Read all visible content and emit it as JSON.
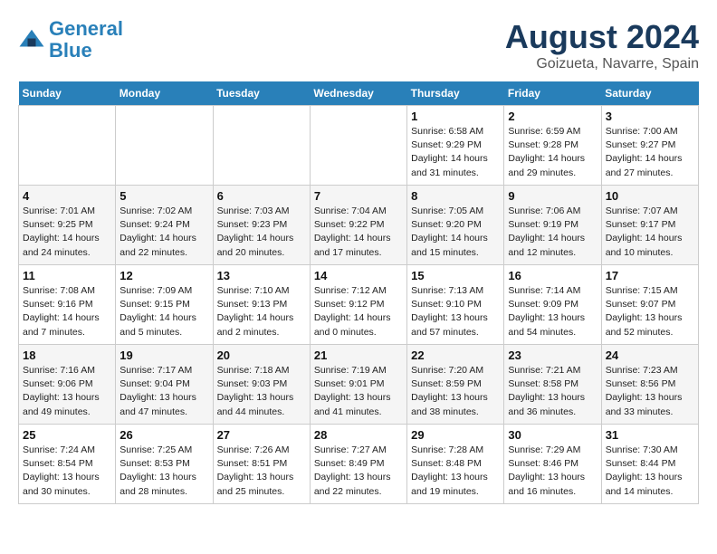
{
  "header": {
    "logo_line1": "General",
    "logo_line2": "Blue",
    "month_title": "August 2024",
    "location": "Goizueta, Navarre, Spain"
  },
  "weekdays": [
    "Sunday",
    "Monday",
    "Tuesday",
    "Wednesday",
    "Thursday",
    "Friday",
    "Saturday"
  ],
  "weeks": [
    [
      {
        "day": "",
        "sunrise": "",
        "sunset": "",
        "daylight": ""
      },
      {
        "day": "",
        "sunrise": "",
        "sunset": "",
        "daylight": ""
      },
      {
        "day": "",
        "sunrise": "",
        "sunset": "",
        "daylight": ""
      },
      {
        "day": "",
        "sunrise": "",
        "sunset": "",
        "daylight": ""
      },
      {
        "day": "1",
        "sunrise": "Sunrise: 6:58 AM",
        "sunset": "Sunset: 9:29 PM",
        "daylight": "Daylight: 14 hours and 31 minutes."
      },
      {
        "day": "2",
        "sunrise": "Sunrise: 6:59 AM",
        "sunset": "Sunset: 9:28 PM",
        "daylight": "Daylight: 14 hours and 29 minutes."
      },
      {
        "day": "3",
        "sunrise": "Sunrise: 7:00 AM",
        "sunset": "Sunset: 9:27 PM",
        "daylight": "Daylight: 14 hours and 27 minutes."
      }
    ],
    [
      {
        "day": "4",
        "sunrise": "Sunrise: 7:01 AM",
        "sunset": "Sunset: 9:25 PM",
        "daylight": "Daylight: 14 hours and 24 minutes."
      },
      {
        "day": "5",
        "sunrise": "Sunrise: 7:02 AM",
        "sunset": "Sunset: 9:24 PM",
        "daylight": "Daylight: 14 hours and 22 minutes."
      },
      {
        "day": "6",
        "sunrise": "Sunrise: 7:03 AM",
        "sunset": "Sunset: 9:23 PM",
        "daylight": "Daylight: 14 hours and 20 minutes."
      },
      {
        "day": "7",
        "sunrise": "Sunrise: 7:04 AM",
        "sunset": "Sunset: 9:22 PM",
        "daylight": "Daylight: 14 hours and 17 minutes."
      },
      {
        "day": "8",
        "sunrise": "Sunrise: 7:05 AM",
        "sunset": "Sunset: 9:20 PM",
        "daylight": "Daylight: 14 hours and 15 minutes."
      },
      {
        "day": "9",
        "sunrise": "Sunrise: 7:06 AM",
        "sunset": "Sunset: 9:19 PM",
        "daylight": "Daylight: 14 hours and 12 minutes."
      },
      {
        "day": "10",
        "sunrise": "Sunrise: 7:07 AM",
        "sunset": "Sunset: 9:17 PM",
        "daylight": "Daylight: 14 hours and 10 minutes."
      }
    ],
    [
      {
        "day": "11",
        "sunrise": "Sunrise: 7:08 AM",
        "sunset": "Sunset: 9:16 PM",
        "daylight": "Daylight: 14 hours and 7 minutes."
      },
      {
        "day": "12",
        "sunrise": "Sunrise: 7:09 AM",
        "sunset": "Sunset: 9:15 PM",
        "daylight": "Daylight: 14 hours and 5 minutes."
      },
      {
        "day": "13",
        "sunrise": "Sunrise: 7:10 AM",
        "sunset": "Sunset: 9:13 PM",
        "daylight": "Daylight: 14 hours and 2 minutes."
      },
      {
        "day": "14",
        "sunrise": "Sunrise: 7:12 AM",
        "sunset": "Sunset: 9:12 PM",
        "daylight": "Daylight: 14 hours and 0 minutes."
      },
      {
        "day": "15",
        "sunrise": "Sunrise: 7:13 AM",
        "sunset": "Sunset: 9:10 PM",
        "daylight": "Daylight: 13 hours and 57 minutes."
      },
      {
        "day": "16",
        "sunrise": "Sunrise: 7:14 AM",
        "sunset": "Sunset: 9:09 PM",
        "daylight": "Daylight: 13 hours and 54 minutes."
      },
      {
        "day": "17",
        "sunrise": "Sunrise: 7:15 AM",
        "sunset": "Sunset: 9:07 PM",
        "daylight": "Daylight: 13 hours and 52 minutes."
      }
    ],
    [
      {
        "day": "18",
        "sunrise": "Sunrise: 7:16 AM",
        "sunset": "Sunset: 9:06 PM",
        "daylight": "Daylight: 13 hours and 49 minutes."
      },
      {
        "day": "19",
        "sunrise": "Sunrise: 7:17 AM",
        "sunset": "Sunset: 9:04 PM",
        "daylight": "Daylight: 13 hours and 47 minutes."
      },
      {
        "day": "20",
        "sunrise": "Sunrise: 7:18 AM",
        "sunset": "Sunset: 9:03 PM",
        "daylight": "Daylight: 13 hours and 44 minutes."
      },
      {
        "day": "21",
        "sunrise": "Sunrise: 7:19 AM",
        "sunset": "Sunset: 9:01 PM",
        "daylight": "Daylight: 13 hours and 41 minutes."
      },
      {
        "day": "22",
        "sunrise": "Sunrise: 7:20 AM",
        "sunset": "Sunset: 8:59 PM",
        "daylight": "Daylight: 13 hours and 38 minutes."
      },
      {
        "day": "23",
        "sunrise": "Sunrise: 7:21 AM",
        "sunset": "Sunset: 8:58 PM",
        "daylight": "Daylight: 13 hours and 36 minutes."
      },
      {
        "day": "24",
        "sunrise": "Sunrise: 7:23 AM",
        "sunset": "Sunset: 8:56 PM",
        "daylight": "Daylight: 13 hours and 33 minutes."
      }
    ],
    [
      {
        "day": "25",
        "sunrise": "Sunrise: 7:24 AM",
        "sunset": "Sunset: 8:54 PM",
        "daylight": "Daylight: 13 hours and 30 minutes."
      },
      {
        "day": "26",
        "sunrise": "Sunrise: 7:25 AM",
        "sunset": "Sunset: 8:53 PM",
        "daylight": "Daylight: 13 hours and 28 minutes."
      },
      {
        "day": "27",
        "sunrise": "Sunrise: 7:26 AM",
        "sunset": "Sunset: 8:51 PM",
        "daylight": "Daylight: 13 hours and 25 minutes."
      },
      {
        "day": "28",
        "sunrise": "Sunrise: 7:27 AM",
        "sunset": "Sunset: 8:49 PM",
        "daylight": "Daylight: 13 hours and 22 minutes."
      },
      {
        "day": "29",
        "sunrise": "Sunrise: 7:28 AM",
        "sunset": "Sunset: 8:48 PM",
        "daylight": "Daylight: 13 hours and 19 minutes."
      },
      {
        "day": "30",
        "sunrise": "Sunrise: 7:29 AM",
        "sunset": "Sunset: 8:46 PM",
        "daylight": "Daylight: 13 hours and 16 minutes."
      },
      {
        "day": "31",
        "sunrise": "Sunrise: 7:30 AM",
        "sunset": "Sunset: 8:44 PM",
        "daylight": "Daylight: 13 hours and 14 minutes."
      }
    ]
  ]
}
